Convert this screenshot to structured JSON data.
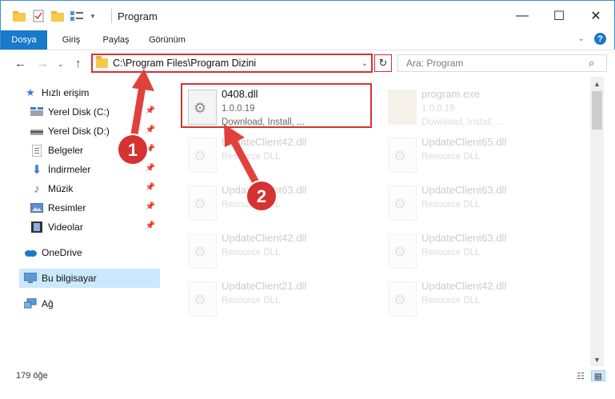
{
  "window": {
    "title": "Program",
    "controls": {
      "minimize": "—",
      "maximize": "☐",
      "close": "✕"
    }
  },
  "ribbon": {
    "tabs": [
      {
        "label": "Dosya",
        "active": true
      },
      {
        "label": "Giriş",
        "active": false
      },
      {
        "label": "Paylaş",
        "active": false
      },
      {
        "label": "Görünüm",
        "active": false
      }
    ],
    "expand_icon": "chevron-down-icon",
    "help": "?"
  },
  "address": {
    "path": "C:\\Program Files\\Program Dizini",
    "search_placeholder": "Ara: Program"
  },
  "sidebar": {
    "items": [
      {
        "label": "Hızlı erişim",
        "icon": "star-icon",
        "pinned": false
      },
      {
        "label": "Yerel Disk (C:)",
        "icon": "drive-icon",
        "pinned": true
      },
      {
        "label": "Yerel Disk (D:)",
        "icon": "drive-icon",
        "pinned": true
      },
      {
        "label": "Belgeler",
        "icon": "document-icon",
        "pinned": true
      },
      {
        "label": "İndirmeler",
        "icon": "download-icon",
        "pinned": true
      },
      {
        "label": "Müzik",
        "icon": "music-icon",
        "pinned": true
      },
      {
        "label": "Resimler",
        "icon": "pictures-icon",
        "pinned": true
      },
      {
        "label": "Videolar",
        "icon": "video-icon",
        "pinned": true
      },
      {
        "label": "OneDrive",
        "icon": "cloud-icon",
        "pinned": false
      },
      {
        "label": "Bu bilgisayar",
        "icon": "computer-icon",
        "pinned": false,
        "selected": true
      },
      {
        "label": "Ağ",
        "icon": "network-icon",
        "pinned": false
      }
    ]
  },
  "files": [
    {
      "name": "0408.dll",
      "version": "1.0.0.19",
      "desc": "Download, Install, ...",
      "highlighted": true
    },
    {
      "name": "program.exe",
      "version": "1.0.0.19",
      "desc": "Download, Install, ...",
      "faded": true
    },
    {
      "name": "UpdateClient42.dll",
      "desc": "Resource DLL",
      "faded": true
    },
    {
      "name": "UpdateClient65.dll",
      "desc": "Resource DLL",
      "faded": true
    },
    {
      "name": "UpdateClient63.dll",
      "desc": "Resource DLL",
      "faded": true
    },
    {
      "name": "UpdateClient63.dll",
      "desc": "Resource DLL",
      "faded": true
    },
    {
      "name": "UpdateClient42.dll",
      "desc": "Resource DLL",
      "faded": true
    },
    {
      "name": "UpdateClient63.dll",
      "desc": "Resource DLL",
      "faded": true
    },
    {
      "name": "UpdateClient21.dll",
      "desc": "Resource DLL",
      "faded": true
    },
    {
      "name": "UpdateClient42.dll",
      "desc": "Resource DLL",
      "faded": true
    }
  ],
  "status": {
    "count": "179 öğe"
  },
  "annotations": [
    {
      "number": "1",
      "color": "#d63232"
    },
    {
      "number": "2",
      "color": "#d63232"
    }
  ]
}
